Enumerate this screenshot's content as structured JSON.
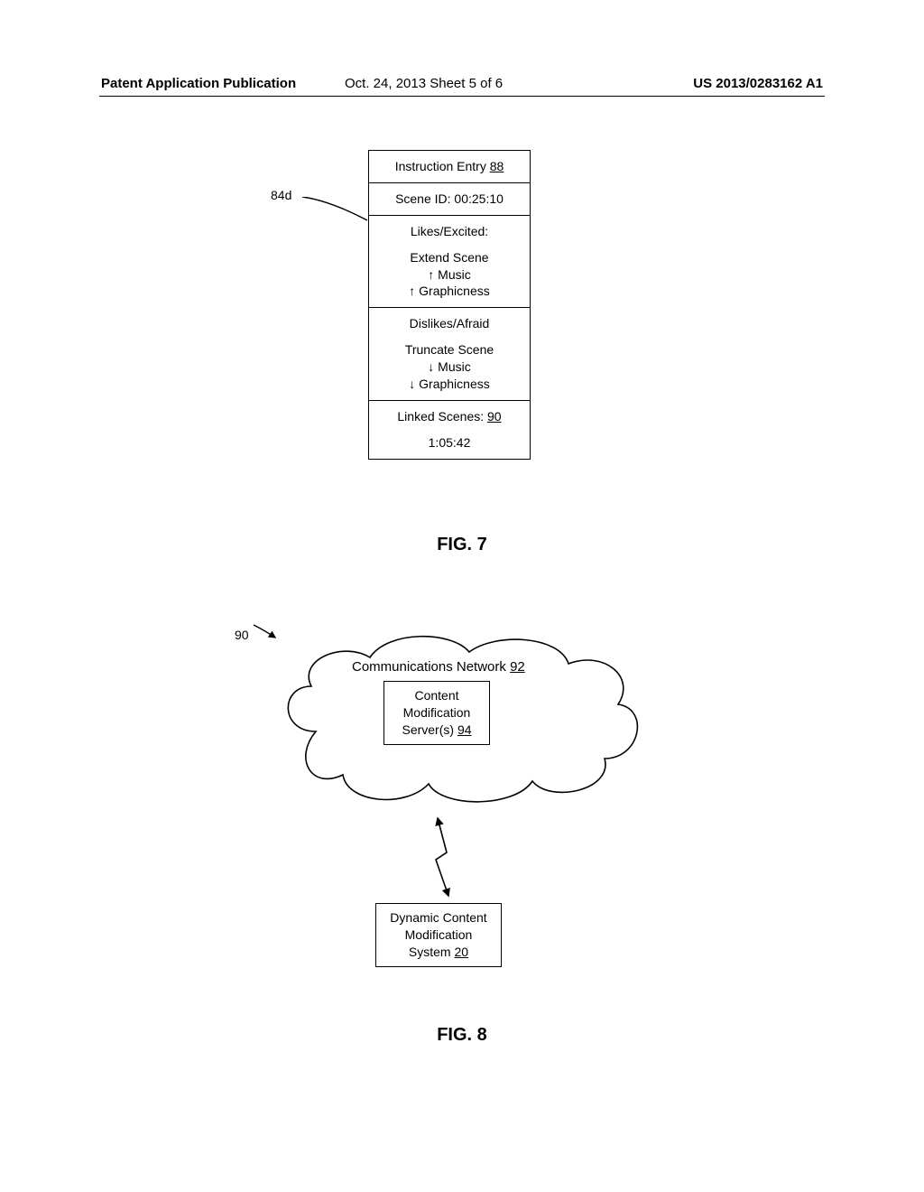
{
  "header": {
    "left": "Patent Application Publication",
    "center": "Oct. 24, 2013  Sheet 5 of 6",
    "right": "US 2013/0283162 A1"
  },
  "fig7": {
    "ref_label": "84d",
    "caption": "FIG. 7",
    "cells": {
      "title_pre": "Instruction Entry ",
      "title_num": "88",
      "scene_id": "Scene ID: 00:25:10",
      "likes_header": "Likes/Excited:",
      "likes_l1": "Extend Scene",
      "likes_l2": "↑ Music",
      "likes_l3": "↑ Graphicness",
      "dislikes_header": "Dislikes/Afraid",
      "dislikes_l1": "Truncate Scene",
      "dislikes_l2": "↓ Music",
      "dislikes_l3": "↓ Graphicness",
      "linked_pre": "Linked Scenes: ",
      "linked_num": "90",
      "linked_time": "1:05:42"
    }
  },
  "fig8": {
    "ref_label": "90",
    "caption": "FIG. 8",
    "cloud_label_pre": "Communications Network ",
    "cloud_label_num": "92",
    "server_l1": "Content",
    "server_l2": "Modification",
    "server_l3_pre": "Server(s) ",
    "server_l3_num": "94",
    "dcm_l1": "Dynamic Content",
    "dcm_l2": "Modification",
    "dcm_l3_pre": "System ",
    "dcm_l3_num": "20"
  }
}
